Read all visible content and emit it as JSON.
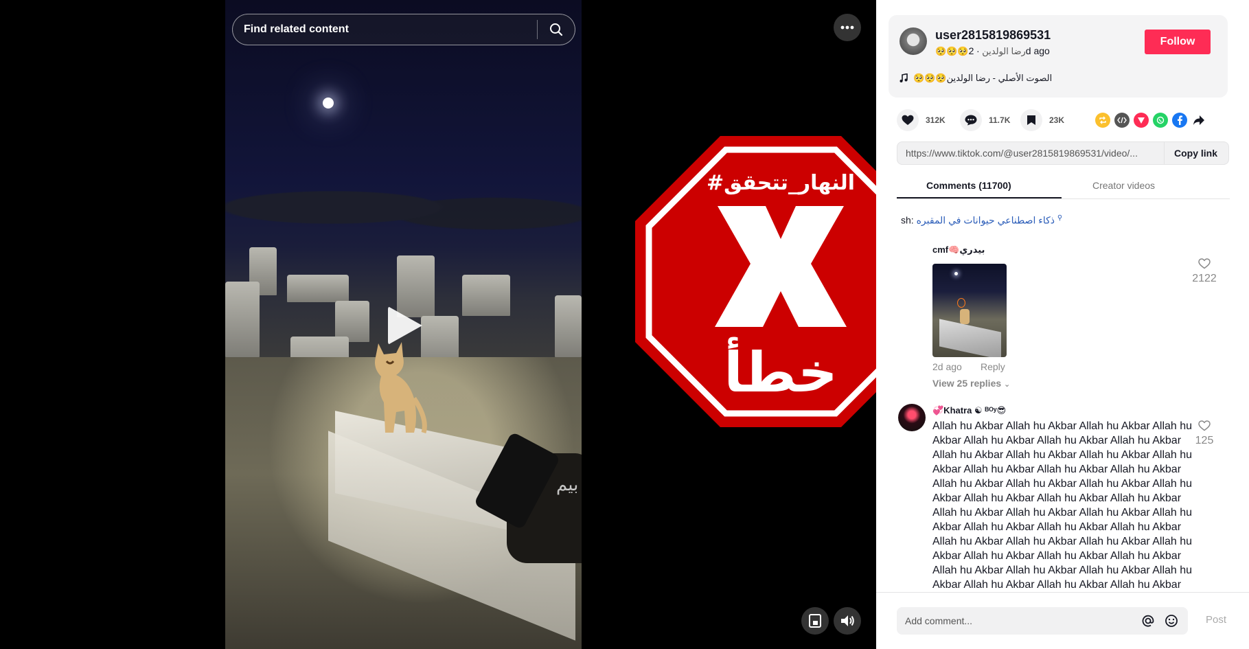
{
  "video": {
    "search_placeholder": "Find related content",
    "watermark_text": "بيم"
  },
  "overlay": {
    "hashtag": "#النهار_تتحقق",
    "verdict": "خطأ",
    "colors": {
      "red": "#cc0000",
      "white": "#ffffff"
    }
  },
  "author": {
    "username": "user2815819869531",
    "nickname": "🥺🥺🥺رضا الولدين",
    "separator": "·",
    "posted": "2d ago",
    "follow_label": "Follow",
    "music": "🥺🥺🥺الصوت الأصلي - رضا الولدين"
  },
  "actions": {
    "likes": "312K",
    "comments": "11.7K",
    "saves": "23K"
  },
  "share_icons": [
    "repost-icon",
    "embed-icon",
    "send-icon",
    "whatsapp-icon",
    "facebook-icon",
    "share-arrow-icon"
  ],
  "link": {
    "url": "https://www.tiktok.com/@user2815819869531/video/...",
    "copy_label": "Copy link"
  },
  "tabs": {
    "comments": "Comments (11700)",
    "creator": "Creator videos"
  },
  "search_suggestion": {
    "prefix": "sh:",
    "query": "ذكاء اصطناعي حيوانات في المقبره"
  },
  "comments": [
    {
      "user": "cmf🧠بيدري",
      "posted": "2d ago",
      "reply_label": "Reply",
      "likes": "2122",
      "replies_label": "View 25 replies"
    },
    {
      "user": "💞Khatra ☯ ᴮᴼʸ😎",
      "text": "Allah hu Akbar Allah hu Akbar Allah hu Akbar Allah hu Akbar Allah hu Akbar Allah hu Akbar Allah hu Akbar Allah hu Akbar Allah hu Akbar Allah hu Akbar Allah hu Akbar Allah hu Akbar Allah hu Akbar Allah hu Akbar Allah hu Akbar Allah hu Akbar Allah hu Akbar Allah hu Akbar Allah hu Akbar Allah hu Akbar Allah hu Akbar Allah hu Akbar Allah hu Akbar Allah hu Akbar Allah hu Akbar Allah hu Akbar Allah hu Akbar Allah hu Akbar Allah hu Akbar Allah hu Akbar Allah hu Akbar Allah hu Akbar Allah hu Akbar Allah hu Akbar Allah hu Akbar Allah hu Akbar Allah hu Akbar Allah hu Akbar Allah hu Akbar Allah hu Akbar Allah hu Akbar Allah hu Akbar Allah hu Akbar Allah hu Akbar Allah hu Akbar",
      "likes": "125"
    }
  ],
  "composer": {
    "placeholder": "Add comment...",
    "post_label": "Post"
  }
}
